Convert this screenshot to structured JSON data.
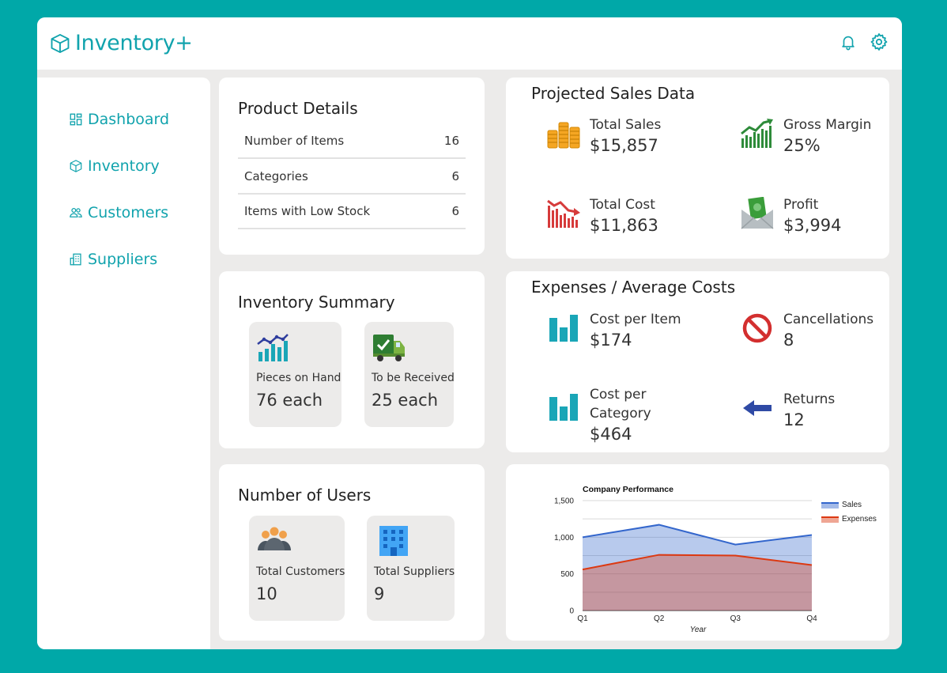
{
  "app": {
    "title": "Inventory+"
  },
  "header": {
    "bell_icon": "bell-icon",
    "settings_icon": "gear-icon"
  },
  "sidebar": {
    "items": [
      {
        "label": "Dashboard",
        "icon": "dashboard-icon"
      },
      {
        "label": "Inventory",
        "icon": "cube-icon"
      },
      {
        "label": "Customers",
        "icon": "users-icon"
      },
      {
        "label": "Suppliers",
        "icon": "building-icon"
      }
    ]
  },
  "product_details": {
    "title": "Product Details",
    "rows": [
      {
        "label": "Number of Items",
        "value": "16"
      },
      {
        "label": "Categories",
        "value": "6"
      },
      {
        "label": "Items with Low Stock",
        "value": "6"
      }
    ]
  },
  "inventory_summary": {
    "title": "Inventory Summary",
    "tiles": [
      {
        "label": "Pieces on Hand",
        "value": "76 each",
        "icon": "chart-trend-icon"
      },
      {
        "label": "To be Received",
        "value": "25 each",
        "icon": "delivery-truck-icon"
      }
    ]
  },
  "users": {
    "title": "Number of Users",
    "tiles": [
      {
        "label": "Total Customers",
        "value": "10",
        "icon": "people-group-icon"
      },
      {
        "label": "Total Suppliers",
        "value": "9",
        "icon": "office-building-icon"
      }
    ]
  },
  "projected_sales": {
    "title": "Projected Sales Data",
    "metrics": [
      {
        "label": "Total Sales",
        "value": "$15,857",
        "icon": "coins-icon"
      },
      {
        "label": "Gross Margin",
        "value": "25%",
        "icon": "growth-chart-icon"
      },
      {
        "label": "Total Cost",
        "value": "$11,863",
        "icon": "decline-chart-icon"
      },
      {
        "label": "Profit",
        "value": "$3,994",
        "icon": "money-envelope-icon"
      }
    ]
  },
  "expenses": {
    "title": "Expenses / Average Costs",
    "metrics": [
      {
        "label": "Cost per Item",
        "value": "$174",
        "icon": "bar-chart-icon"
      },
      {
        "label": "Cancellations",
        "value": "8",
        "icon": "prohibited-icon"
      },
      {
        "label": "Cost per Category",
        "value": "$464",
        "icon": "bar-chart-icon"
      },
      {
        "label": "Returns",
        "value": "12",
        "icon": "arrow-left-icon"
      }
    ]
  },
  "colors": {
    "accent": "#11a3ad",
    "background": "#00a8a8",
    "sales": "#3366cc",
    "expenses": "#dc3912"
  },
  "chart_data": {
    "type": "area",
    "title": "Company Performance",
    "xlabel": "Year",
    "ylabel": "",
    "categories": [
      "Q1",
      "Q2",
      "Q3",
      "Q4"
    ],
    "series": [
      {
        "name": "Sales",
        "values": [
          1000,
          1170,
          900,
          1030
        ],
        "color": "#3366cc"
      },
      {
        "name": "Expenses",
        "values": [
          560,
          760,
          750,
          620
        ],
        "color": "#dc3912"
      }
    ],
    "ylim": [
      0,
      1500
    ],
    "yticks": [
      "0",
      "500",
      "1,000",
      "1,500"
    ],
    "grid": true,
    "legend": "right"
  }
}
